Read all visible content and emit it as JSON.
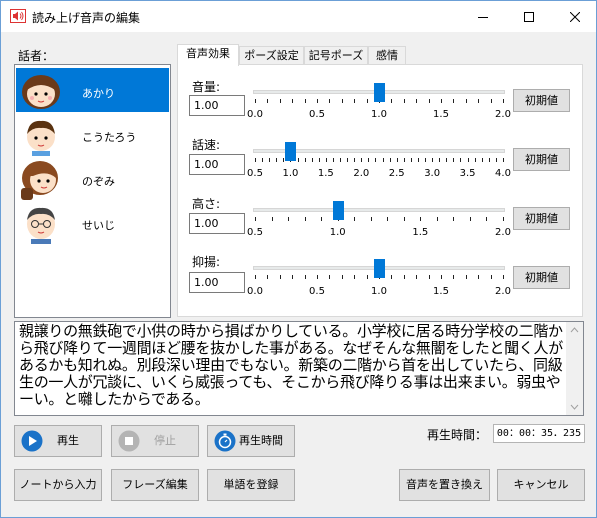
{
  "window": {
    "title": "読み上げ音声の編集"
  },
  "speakers": {
    "label": "話者：",
    "items": [
      {
        "name": "あかり",
        "selected": true
      },
      {
        "name": "こうたろう",
        "selected": false
      },
      {
        "name": "のぞみ",
        "selected": false
      },
      {
        "name": "せいじ",
        "selected": false
      }
    ]
  },
  "tabs": [
    "音声効果",
    "ポーズ設定",
    "記号ポーズ",
    "感情"
  ],
  "params": [
    {
      "label": "音量:",
      "value": "1.00",
      "min": 0,
      "max": 2,
      "ticks": [
        "0.0",
        "0.5",
        "1.0",
        "1.5",
        "2.0"
      ],
      "reset": "初期値"
    },
    {
      "label": "話速:",
      "value": "1.00",
      "min": 0.5,
      "max": 4,
      "ticks": [
        "0.5",
        "1.0",
        "1.5",
        "2.0",
        "2.5",
        "3.0",
        "3.5",
        "4.0"
      ],
      "reset": "初期値"
    },
    {
      "label": "高さ:",
      "value": "1.00",
      "min": 0.5,
      "max": 2,
      "ticks": [
        "0.5",
        "1.0",
        "1.5",
        "2.0"
      ],
      "reset": "初期値"
    },
    {
      "label": "抑揚:",
      "value": "1.00",
      "min": 0,
      "max": 2,
      "ticks": [
        "0.0",
        "0.5",
        "1.0",
        "1.5",
        "2.0"
      ],
      "reset": "初期値"
    }
  ],
  "text": "親譲りの無鉄砲で小供の時から損ばかりしている。小学校に居る時分学校の二階から飛び降りて一週間ほど腰を抜かした事がある。なぜそんな無闇をしたと聞く人があるかも知れぬ。別段深い理由でもない。新築の二階から首を出していたら、同級生の一人が冗談に、いくら威張っても、そこから飛び降りる事は出来まい。弱虫やーい。と囃したからである。",
  "playback": {
    "play": "再生",
    "stop": "停止",
    "time": "再生時間",
    "time_label": "再生時間：",
    "time_value": "00：00：35．235"
  },
  "footer": {
    "from_notes": "ノートから入力",
    "phrase_edit": "フレーズ編集",
    "register_word": "単語を登録",
    "replace": "音声を置き換え",
    "cancel": "キャンセル"
  },
  "colors": {
    "accent": "#0078d7",
    "button": "#e1e1e1",
    "window_border": "#6b9fd6"
  }
}
